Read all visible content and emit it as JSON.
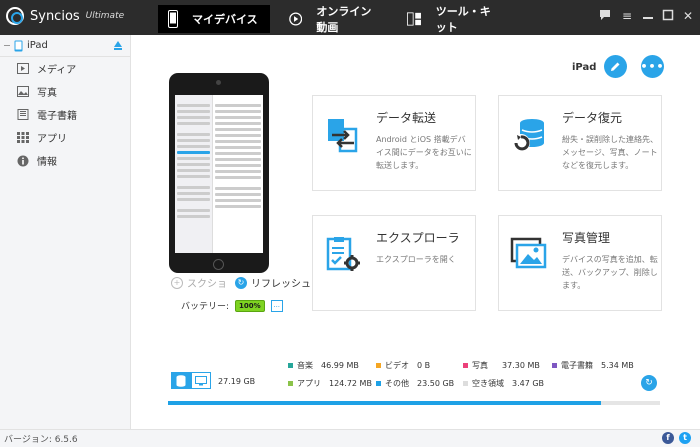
{
  "app": {
    "name": "Syncios",
    "edition": "Ultimate"
  },
  "tabs": [
    {
      "label": "マイデバイス",
      "icon": "phone-icon",
      "active": true
    },
    {
      "label": "オンライン動画",
      "icon": "play-icon",
      "active": false
    },
    {
      "label": "ツール・キット",
      "icon": "toolkit-icon",
      "active": false
    }
  ],
  "window_controls": [
    "chat-icon",
    "menu-icon",
    "minimize-icon",
    "maximize-icon",
    "close-icon"
  ],
  "sidebar": {
    "device": "iPad",
    "items": [
      {
        "label": "メディア",
        "icon": "media-icon"
      },
      {
        "label": "写真",
        "icon": "photo-icon"
      },
      {
        "label": "電子書籍",
        "icon": "book-icon"
      },
      {
        "label": "アプリ",
        "icon": "apps-icon"
      },
      {
        "label": "情報",
        "icon": "info-icon"
      }
    ]
  },
  "device_panel": {
    "name": "iPad",
    "screenshot_label": "スクショ",
    "refresh_label": "リフレッシュ",
    "battery_label": "バッテリー:",
    "battery_value": "100%",
    "more_label": "..."
  },
  "cards": [
    {
      "title": "データ転送",
      "desc": "Android とiOS 搭載デバイス間にデータをお互いに転送します。",
      "icon": "transfer-icon"
    },
    {
      "title": "データ復元",
      "desc": "紛失・誤削除した連絡先、メッセージ、写真、ノートなどを復元します。",
      "icon": "restore-icon"
    },
    {
      "title": "エクスプローラ",
      "desc": "エクスプローラを開く",
      "icon": "explorer-icon"
    },
    {
      "title": "写真管理",
      "desc": "デバイスの写真を追加、転送、バックアップ、削除します。",
      "icon": "photo-manager-icon"
    }
  ],
  "storage": {
    "total": "27.19 GB",
    "used_fraction": 0.88,
    "legend": [
      {
        "label": "音楽",
        "value": "46.99 MB",
        "color": "#26a69a"
      },
      {
        "label": "ビデオ",
        "value": "0 B",
        "color": "#f5a623"
      },
      {
        "label": "写真",
        "value": "37.30 MB",
        "color": "#ec407a"
      },
      {
        "label": "電子書籍",
        "value": "5.34 MB",
        "color": "#7e57c2"
      },
      {
        "label": "アプリ",
        "value": "124.72 MB",
        "color": "#8bc34a"
      },
      {
        "label": "その他",
        "value": "23.50 GB",
        "color": "#1ea1e6"
      },
      {
        "label": "空き領域",
        "value": "3.47 GB",
        "color": "#dddddd"
      }
    ]
  },
  "status": {
    "version": "バージョン: 6.5.6"
  },
  "social": [
    {
      "label": "f",
      "color": "#3b5998"
    },
    {
      "label": "t",
      "color": "#1da1f2"
    }
  ],
  "accent": "#2aa4e8"
}
